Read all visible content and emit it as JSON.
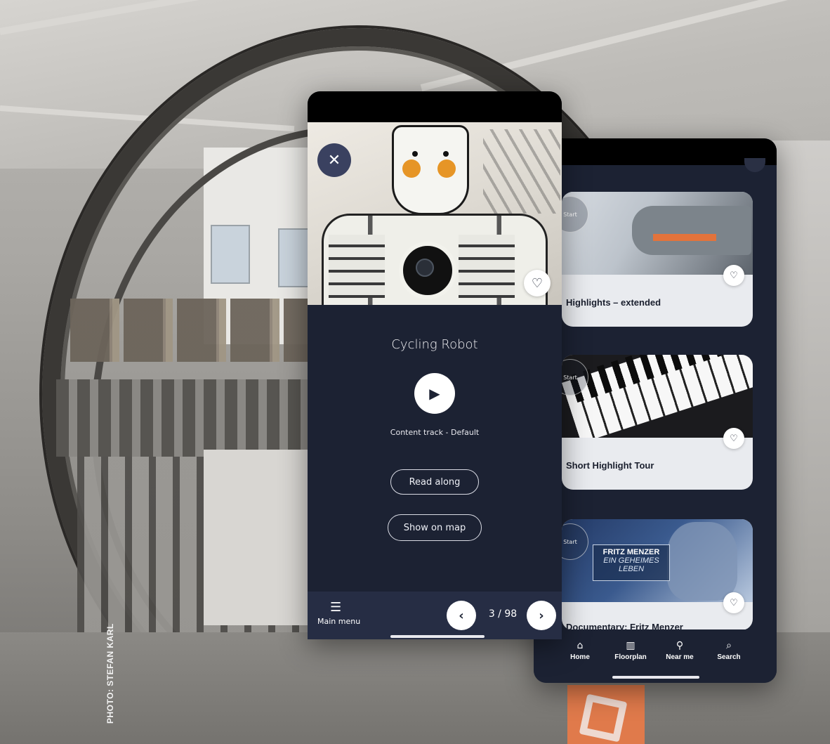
{
  "photo_credit": "PHOTO: STEFAN KARL",
  "front_screen": {
    "close_icon": "close-icon",
    "favorite_icon": "heart-icon",
    "title": "Cycling Robot",
    "play_icon": "play-icon",
    "track_label": "Content track - Default",
    "read_along_label": "Read along",
    "show_on_map_label": "Show on map",
    "nav": {
      "menu_label": "Main menu",
      "page_counter": "3 / 98"
    }
  },
  "back_screen": {
    "tours": [
      {
        "start_label": "Start",
        "title": "Highlights – extended"
      },
      {
        "start_label": "Start",
        "title": "Short Highlight Tour"
      },
      {
        "start_label": "Start",
        "title": "Documentary: Fritz Menzer",
        "poster_line1": "FRITZ MENZER",
        "poster_line2": "EIN GEHEIMES",
        "poster_line3": "LEBEN"
      }
    ],
    "nav": [
      {
        "label": "Home",
        "icon": "home-icon"
      },
      {
        "label": "Floorplan",
        "icon": "map-icon"
      },
      {
        "label": "Near me",
        "icon": "location-pin-icon"
      },
      {
        "label": "Search",
        "icon": "search-icon"
      }
    ]
  },
  "colors": {
    "screen_bg": "#1c2233",
    "nav_bg": "#262d44",
    "accent_orange": "#e69526"
  }
}
